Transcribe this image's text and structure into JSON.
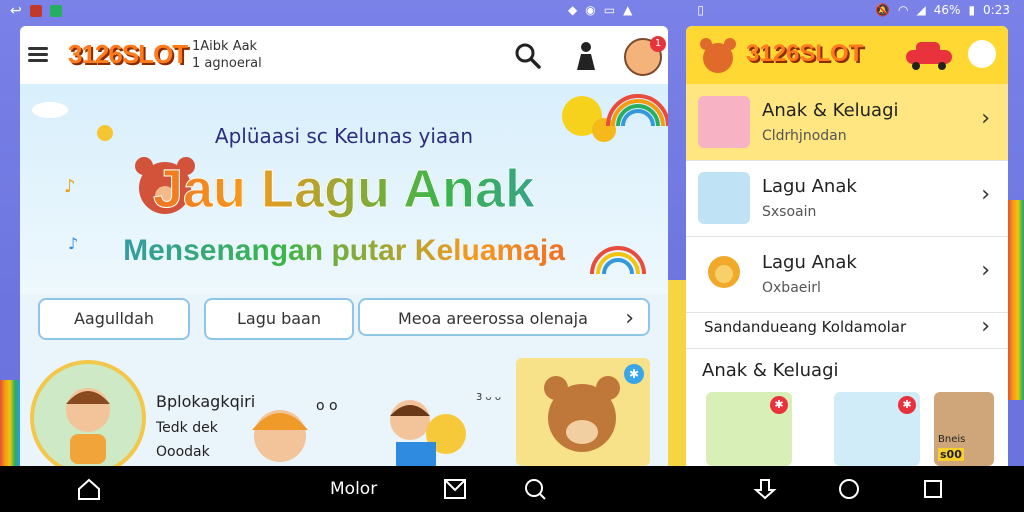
{
  "status_bar": {
    "battery": "46%",
    "time": "0:23"
  },
  "left_app": {
    "logo": "3126SLOT",
    "subtitle_1": "1Aibk Aak",
    "subtitle_2": "1 agnoeral",
    "notification_badge": "1",
    "hero": {
      "subtitle": "Aplüaasi sc Kelunas yiaan",
      "title": "Jau Lagu Anak",
      "tagline": "Mensenangan putar Keluamaja"
    },
    "chips": [
      "Aagulldah",
      "Lagu baan",
      "Meoa areerossa olenaja"
    ],
    "chips_chevron": "›",
    "kid_card": {
      "title": "Bplokagkqiri",
      "line_1": "Tedk dek",
      "line_2": "Ooodak"
    },
    "small_label": "3 ᴗ ᴗ",
    "speech": "o o"
  },
  "right_app": {
    "logo": "3126SLOT",
    "items": [
      {
        "title": "Anak & Keluagi",
        "subtitle": "Cldrhjnodan"
      },
      {
        "title": "Lagu Anak",
        "subtitle": "Sxsoain"
      },
      {
        "title": "Lagu Anak",
        "subtitle": "Oxbaeirl"
      }
    ],
    "single_item": "Sandandueang Koldamolar",
    "chevron": "›",
    "section_heading": "Anak & Keluagi",
    "thumb_label": "Bneis",
    "thumb_label_2": "s00"
  },
  "nav_bar": {
    "label": "Molor"
  },
  "colors": {
    "accent_yellow": "#ffd833",
    "logo_orange": "#ff7b1c",
    "nav_bg": "#000000",
    "page_bg": "#6c74df"
  }
}
